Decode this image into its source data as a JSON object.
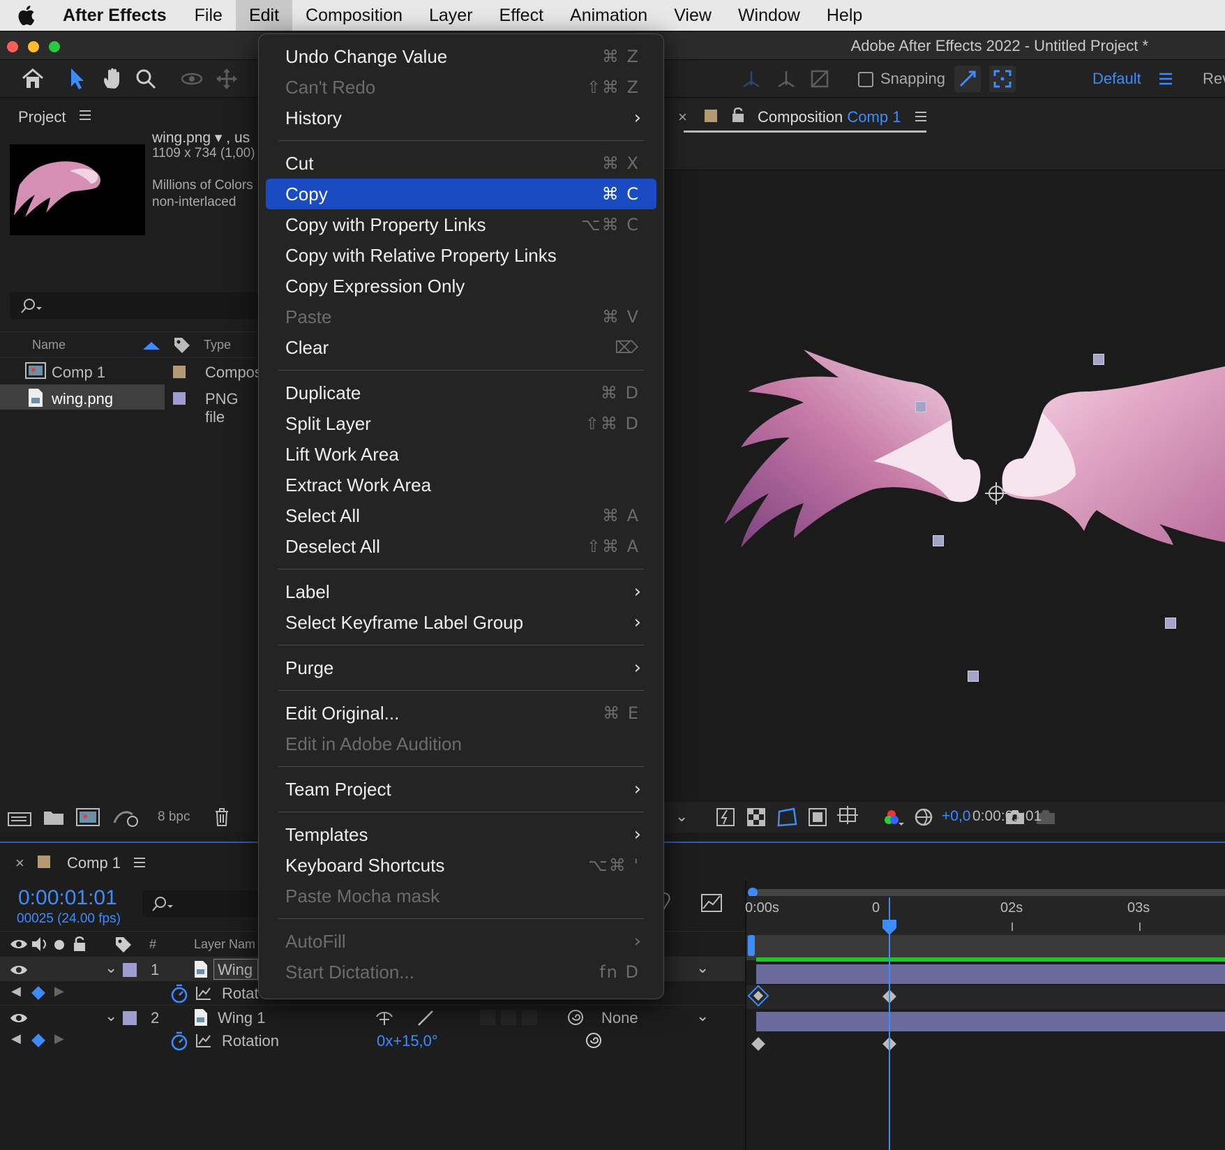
{
  "menubar": {
    "app_name": "After Effects",
    "items": [
      "File",
      "Edit",
      "Composition",
      "Layer",
      "Effect",
      "Animation",
      "View",
      "Window",
      "Help"
    ],
    "active": "Edit"
  },
  "window": {
    "title": "Adobe After Effects 2022 - Untitled Project *"
  },
  "toolbar": {
    "snapping_label": "Snapping",
    "workspace": "Default",
    "workspace_next": "Rev"
  },
  "project": {
    "tab": "Project",
    "footage": {
      "name": "wing.png",
      "name_suffix": ", us",
      "dims": "1109 x 734 (1,00)",
      "colors": "Millions of Colors",
      "interlace": "non-interlaced"
    },
    "columns": {
      "name": "Name",
      "type": "Type"
    },
    "items": [
      {
        "name": "Comp 1",
        "type": "Compos",
        "color": "#b49a72"
      },
      {
        "name": "wing.png",
        "type": "PNG file",
        "color": "#9d9dd0"
      }
    ],
    "bpc": "8 bpc"
  },
  "viewer": {
    "tab_label": "Composition",
    "comp_name": "Comp 1",
    "exposure": "+0,0",
    "timecode": "0:00:01:01"
  },
  "timeline": {
    "tab": "Comp 1",
    "current_time": "0:00:01:01",
    "frame_info": "00025 (24.00 fps)",
    "col_num": "#",
    "col_layer_name": "Layer Nam",
    "ruler": [
      "0:00s",
      "0",
      "02s",
      "03s"
    ],
    "layers": [
      {
        "num": "1",
        "name": "Wing",
        "property": "Rotat"
      },
      {
        "num": "2",
        "name": "Wing 1",
        "property": "Rotation",
        "value": "0x+15,0°",
        "parent": "None"
      }
    ]
  },
  "edit_menu": [
    {
      "label": "Undo Change Value",
      "shortcut": "⌘ Z"
    },
    {
      "label": "Can't Redo",
      "shortcut": "⇧⌘ Z",
      "disabled": true
    },
    {
      "label": "History",
      "submenu": true
    },
    {
      "sep": true
    },
    {
      "label": "Cut",
      "shortcut": "⌘ X"
    },
    {
      "label": "Copy",
      "shortcut": "⌘ C",
      "selected": true
    },
    {
      "label": "Copy with Property Links",
      "shortcut": "⌥⌘ C"
    },
    {
      "label": "Copy with Relative Property Links"
    },
    {
      "label": "Copy Expression Only"
    },
    {
      "label": "Paste",
      "shortcut": "⌘ V",
      "disabled": true
    },
    {
      "label": "Clear",
      "shortcut": "⌦"
    },
    {
      "sep": true
    },
    {
      "label": "Duplicate",
      "shortcut": "⌘ D"
    },
    {
      "label": "Split Layer",
      "shortcut": "⇧⌘ D"
    },
    {
      "label": "Lift Work Area"
    },
    {
      "label": "Extract Work Area"
    },
    {
      "label": "Select All",
      "shortcut": "⌘ A"
    },
    {
      "label": "Deselect All",
      "shortcut": "⇧⌘ A"
    },
    {
      "sep": true
    },
    {
      "label": "Label",
      "submenu": true
    },
    {
      "label": "Select Keyframe Label Group",
      "submenu": true
    },
    {
      "sep": true
    },
    {
      "label": "Purge",
      "submenu": true
    },
    {
      "sep": true
    },
    {
      "label": "Edit Original...",
      "shortcut": "⌘ E"
    },
    {
      "label": "Edit in Adobe Audition",
      "disabled": true
    },
    {
      "sep": true
    },
    {
      "label": "Team Project",
      "submenu": true
    },
    {
      "sep": true
    },
    {
      "label": "Templates",
      "submenu": true
    },
    {
      "label": "Keyboard Shortcuts",
      "shortcut": "⌥⌘ '"
    },
    {
      "label": "Paste Mocha mask",
      "disabled": true
    },
    {
      "sep": true
    },
    {
      "label": "AutoFill",
      "submenu": true,
      "disabled": true
    },
    {
      "label": "Start Dictation...",
      "shortcut": "fn D",
      "disabled": true
    }
  ],
  "colors": {
    "accent": "#3c8cff",
    "menu_highlight": "#1a4bc2",
    "work_area": "#22c22a",
    "layer_bar": "#6a6a9c"
  }
}
